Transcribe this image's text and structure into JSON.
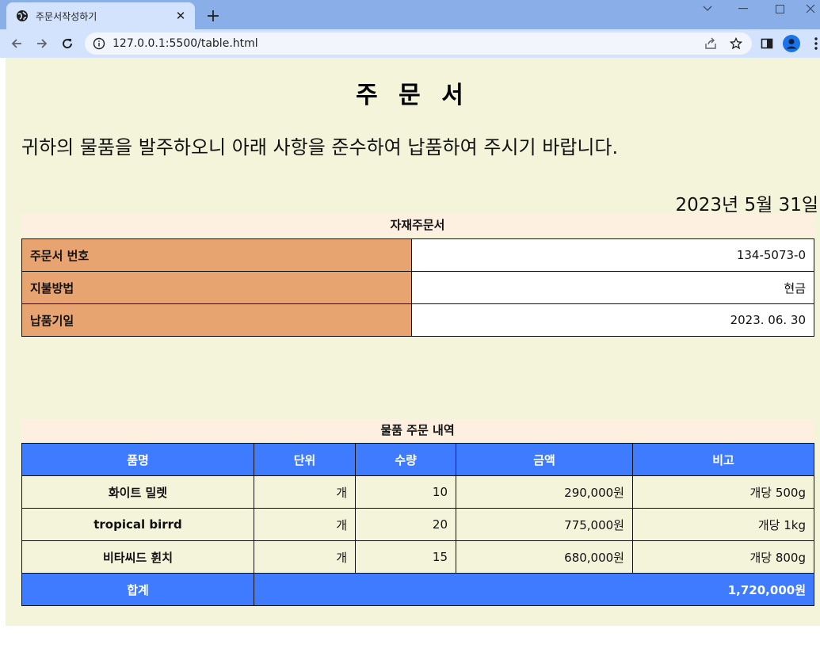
{
  "browser": {
    "tab_title": "주문서작성하기",
    "url": "127.0.0.1:5500/table.html"
  },
  "document": {
    "title": "주 문 서",
    "intro": "귀하의 물품을 발주하오니 아래 사항을 준수하여 납품하여 주시기 바랍니다.",
    "date": "2023년 5월 31일"
  },
  "order_info": {
    "caption": "자재주문서",
    "rows": [
      {
        "label": "주문서 번호",
        "value": "134-5073-0"
      },
      {
        "label": "지불방법",
        "value": "현금"
      },
      {
        "label": "납품기일",
        "value": "2023. 06. 30"
      }
    ]
  },
  "order_items": {
    "caption": "물품 주문 내역",
    "headers": [
      "품명",
      "단위",
      "수량",
      "금액",
      "비고"
    ],
    "rows": [
      {
        "name": "화이트 밀렛",
        "unit": "개",
        "qty": "10",
        "amount": "290,000원",
        "note": "개당 500g"
      },
      {
        "name": "tropical birrd",
        "unit": "개",
        "qty": "20",
        "amount": "775,000원",
        "note": "개당 1kg"
      },
      {
        "name": "비타씨드 휜치",
        "unit": "개",
        "qty": "15",
        "amount": "680,000원",
        "note": "개당 800g"
      }
    ],
    "total_label": "합계",
    "total_value": "1,720,000원"
  },
  "colors": {
    "page_bg": "#f4f4db",
    "caption_bg": "#fdf0e0",
    "label_bg": "#e8a470",
    "header_bg": "#3e7bff"
  }
}
